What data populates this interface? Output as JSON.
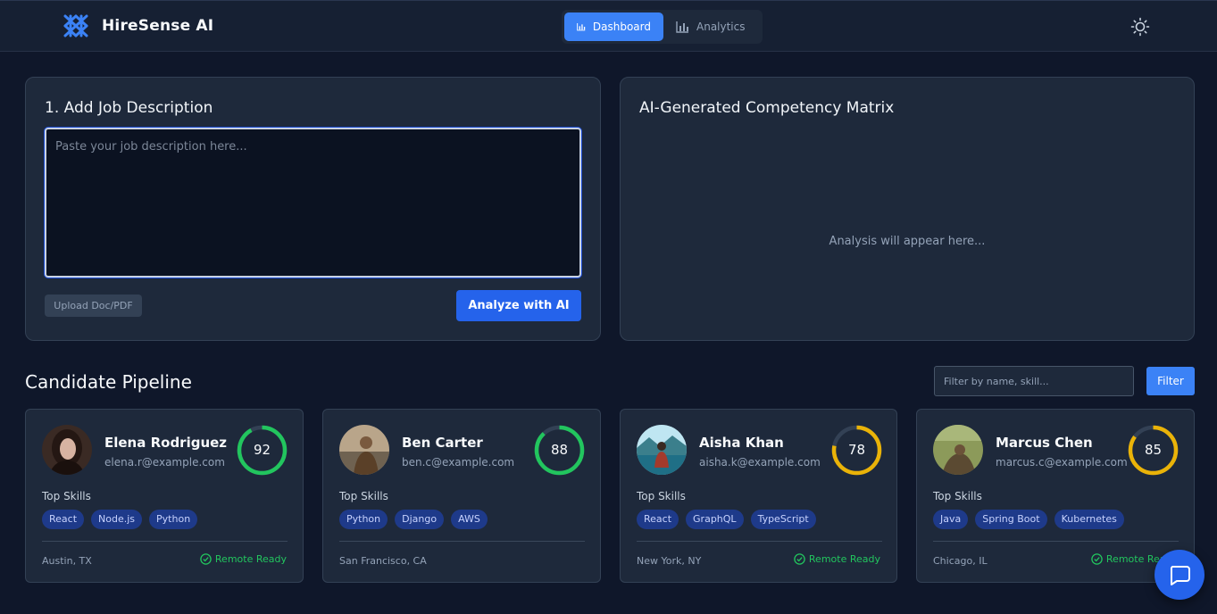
{
  "header": {
    "brand": "HireSense AI",
    "nav": [
      {
        "label": "Dashboard",
        "active": true
      },
      {
        "label": "Analytics",
        "active": false
      }
    ],
    "theme_icon": "sun-icon"
  },
  "job_panel": {
    "title": "1. Add Job Description",
    "textarea_placeholder": "Paste your job description here...",
    "upload_label": "Upload Doc/PDF",
    "analyze_label": "Analyze with AI"
  },
  "matrix_panel": {
    "title": "AI-Generated Competency Matrix",
    "empty_text": "Analysis will appear here..."
  },
  "pipeline": {
    "title": "Candidate Pipeline",
    "filter_placeholder": "Filter by name, skill...",
    "filter_label": "Filter",
    "skills_heading": "Top Skills",
    "remote_label": "Remote Ready",
    "candidates": [
      {
        "name": "Elena Rodriguez",
        "email": "elena.r@example.com",
        "score": "92",
        "skills": [
          "React",
          "Node.js",
          "Python"
        ],
        "location": "Austin, TX",
        "remote": true
      },
      {
        "name": "Ben Carter",
        "email": "ben.c@example.com",
        "score": "88",
        "skills": [
          "Python",
          "Django",
          "AWS"
        ],
        "location": "San Francisco, CA",
        "remote": false
      },
      {
        "name": "Aisha Khan",
        "email": "aisha.k@example.com",
        "score": "78",
        "skills": [
          "React",
          "GraphQL",
          "TypeScript"
        ],
        "location": "New York, NY",
        "remote": true
      },
      {
        "name": "Marcus Chen",
        "email": "marcus.c@example.com",
        "score": "85",
        "skills": [
          "Java",
          "Spring Boot",
          "Kubernetes"
        ],
        "location": "Chicago, IL",
        "remote": true
      }
    ]
  },
  "colors": {
    "accent": "#3b82f6",
    "score_high": "#22c55e",
    "score_mid": "#eab308",
    "remote": "#22c55e"
  }
}
